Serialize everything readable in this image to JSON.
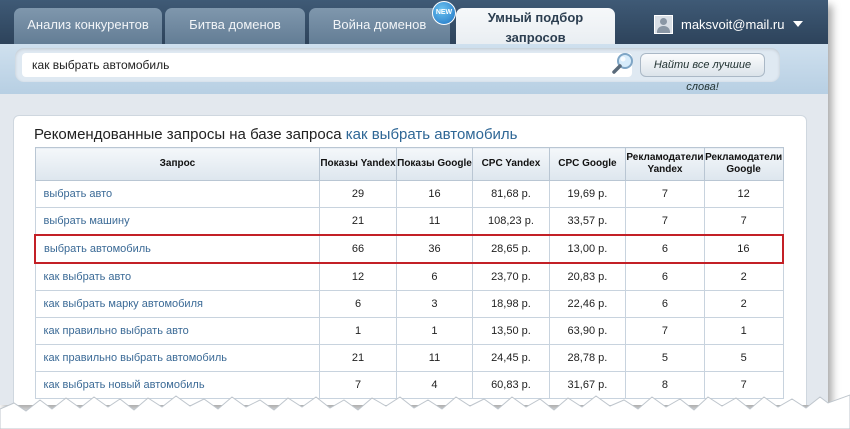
{
  "tabs": [
    {
      "label": "Анализ конкурентов",
      "active": false
    },
    {
      "label": "Битва доменов",
      "active": false
    },
    {
      "label": "Война доменов",
      "active": false,
      "badge": "NEW"
    },
    {
      "label": "Умный подбор запросов",
      "active": true
    }
  ],
  "user": {
    "email": "maksvoit@mail.ru"
  },
  "search": {
    "value": "как выбрать автомобиль",
    "button_label": "Найти все лучшие слова!"
  },
  "results": {
    "heading_prefix": "Рекомендованные запросы на базе запроса",
    "heading_query": "как выбрать автомобиль",
    "columns": [
      "Запрос",
      "Показы Yandex",
      "Показы Google",
      "CPC Yandex",
      "CPC Google",
      "Рекламодатели Yandex",
      "Рекламодатели Google"
    ],
    "rows": [
      [
        "выбрать авто",
        "29",
        "16",
        "81,68 р.",
        "19,69 р.",
        "7",
        "12"
      ],
      [
        "выбрать машину",
        "21",
        "11",
        "108,23 р.",
        "33,57 р.",
        "7",
        "7"
      ],
      [
        "выбрать автомобиль",
        "66",
        "36",
        "28,65 р.",
        "13,00 р.",
        "6",
        "16"
      ],
      [
        "как выбрать авто",
        "12",
        "6",
        "23,70 р.",
        "20,83 р.",
        "6",
        "2"
      ],
      [
        "как выбрать марку автомобиля",
        "6",
        "3",
        "18,98 р.",
        "22,46 р.",
        "6",
        "2"
      ],
      [
        "как правильно выбрать авто",
        "1",
        "1",
        "13,50 р.",
        "63,90 р.",
        "7",
        "1"
      ],
      [
        "как правильно выбрать автомобиль",
        "21",
        "11",
        "24,45 р.",
        "28,78 р.",
        "5",
        "5"
      ],
      [
        "как выбрать новый автомобиль",
        "7",
        "4",
        "60,83 р.",
        "31,67 р.",
        "8",
        "7"
      ]
    ],
    "highlighted_row": 2
  },
  "colors": {
    "nav_bg": "#2d435b",
    "link": "#3b6a96",
    "highlight_border": "#c32026",
    "tab_underline": "#d63a2e"
  },
  "icons": {
    "search": "magnifier-icon",
    "user": "user-avatar-icon",
    "menu": "caret-down-icon"
  }
}
